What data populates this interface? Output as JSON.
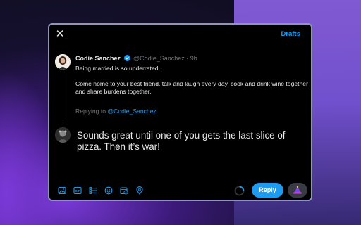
{
  "header": {
    "close_icon": "close-icon",
    "drafts_label": "Drafts"
  },
  "original_tweet": {
    "author_name": "Codie Sanchez",
    "handle_time": "@Codie_Sanchez · 9h",
    "paragraphs": [
      "Being married is so underrated.",
      "Come home to your best friend, talk and laugh every day, cook and drink wine together and share burdens together."
    ]
  },
  "replying_to": {
    "prefix": "Replying to",
    "mention": "@Codie_Sanchez"
  },
  "composer": {
    "text": "Sounds great until one of you gets the last slice of pizza. Then it’s war!"
  },
  "toolbar": {
    "icons": [
      "image-icon",
      "gif-icon",
      "poll-icon",
      "emoji-icon",
      "schedule-icon",
      "location-icon"
    ],
    "reply_label": "Reply",
    "extra_icon": "sparkle-hat-icon"
  },
  "colors": {
    "accent": "#1d9bf0",
    "modal_bg": "#000000",
    "muted": "#71767b"
  }
}
